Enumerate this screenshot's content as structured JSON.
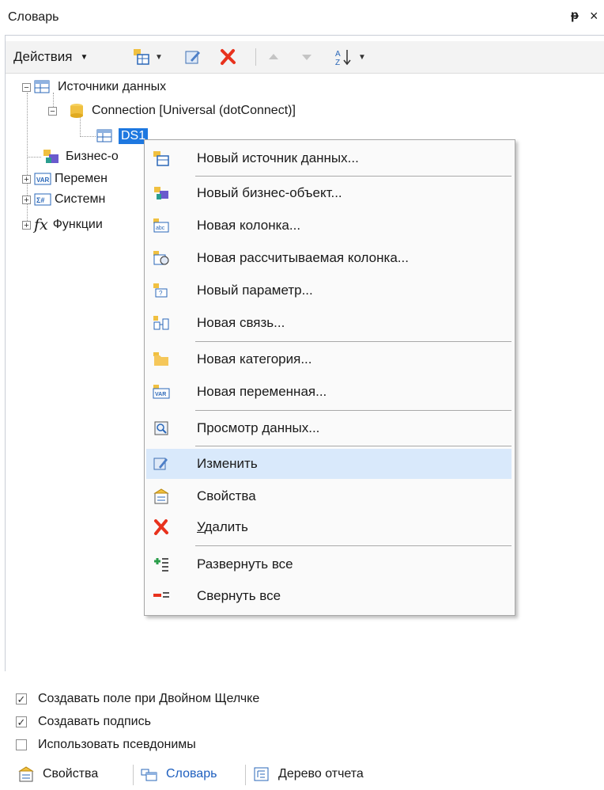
{
  "panel": {
    "title": "Словарь",
    "pin_glyph": "ᵽ",
    "close_glyph": "×"
  },
  "toolbar": {
    "actions_label": "Действия",
    "buttons": [
      "new-datasource-icon",
      "edit-icon",
      "delete-icon",
      "move-up-icon",
      "move-down-icon",
      "sort-az-icon"
    ]
  },
  "tree": {
    "data_sources": "Источники данных",
    "connection": "Connection [Universal (dotConnect)]",
    "ds1": "DS1",
    "business": "Бизнес-о",
    "variables": "Перемен",
    "system": "Системн",
    "functions": "Функции"
  },
  "context_menu": {
    "items": [
      {
        "label": "Новый источник данных...",
        "icon": "new-datasource-icon"
      },
      {
        "label": "Новый бизнес-объект...",
        "icon": "business-object-icon"
      },
      {
        "label": "Новая колонка...",
        "icon": "column-icon"
      },
      {
        "label": "Новая рассчитываемая колонка...",
        "icon": "calc-column-icon"
      },
      {
        "label": "Новый параметр...",
        "icon": "parameter-icon"
      },
      {
        "label": "Новая связь...",
        "icon": "relation-icon"
      },
      {
        "label": "Новая категория...",
        "icon": "folder-icon"
      },
      {
        "label": "Новая переменная...",
        "icon": "variable-icon"
      },
      {
        "label": "Просмотр данных...",
        "icon": "view-data-icon"
      },
      {
        "label": "Изменить",
        "icon": "edit-icon",
        "highlighted": true
      },
      {
        "label": "Свойства",
        "icon": "properties-icon"
      },
      {
        "label_prefix": "У",
        "label_rest": "далить",
        "icon": "delete-icon"
      },
      {
        "label": "Развернуть все",
        "icon": "expand-all-icon"
      },
      {
        "label": "Свернуть все",
        "icon": "collapse-all-icon"
      }
    ]
  },
  "options": [
    {
      "label": "Создавать поле при Двойном Щелчке",
      "checked": true
    },
    {
      "label": "Создавать подпись",
      "checked": true
    },
    {
      "label": "Использовать псевдонимы",
      "checked": false
    }
  ],
  "tabs": [
    {
      "label": "Свойства",
      "active": false
    },
    {
      "label": "Словарь",
      "active": true
    },
    {
      "label": "Дерево отчета",
      "active": false
    }
  ],
  "colors": {
    "selection": "#1e78e0",
    "menu_highlight": "#d9e9fb",
    "delete_red": "#e8321d",
    "active_tab": "#1e5fbf"
  }
}
